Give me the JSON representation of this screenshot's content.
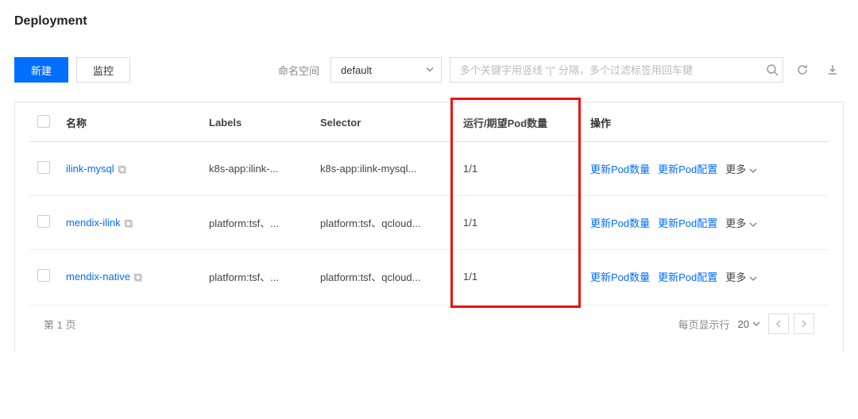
{
  "pageTitle": "Deployment",
  "buttons": {
    "create": "新建",
    "monitor": "监控"
  },
  "namespace": {
    "label": "命名空间",
    "selected": "default"
  },
  "search": {
    "placeholder": "多个关键字用竖线 \"|\" 分隔，多个过滤标签用回车键"
  },
  "headers": {
    "name": "名称",
    "labels": "Labels",
    "selector": "Selector",
    "pods": "运行/期望Pod数量",
    "ops": "操作"
  },
  "rows": [
    {
      "name": "ilink-mysql",
      "labels": "k8s-app:ilink-...",
      "selector": "k8s-app:ilink-mysql...",
      "pods": "1/1"
    },
    {
      "name": "mendix-ilink",
      "labels": "platform:tsf、...",
      "selector": "platform:tsf、qcloud...",
      "pods": "1/1"
    },
    {
      "name": "mendix-native",
      "labels": "platform:tsf、...",
      "selector": "platform:tsf、qcloud...",
      "pods": "1/1"
    }
  ],
  "ops": {
    "updateCount": "更新Pod数量",
    "updateConfig": "更新Pod配置",
    "more": "更多"
  },
  "pagination": {
    "pageInfo": "第 1 页",
    "rowsLabel": "每页显示行",
    "rowsValue": "20"
  }
}
